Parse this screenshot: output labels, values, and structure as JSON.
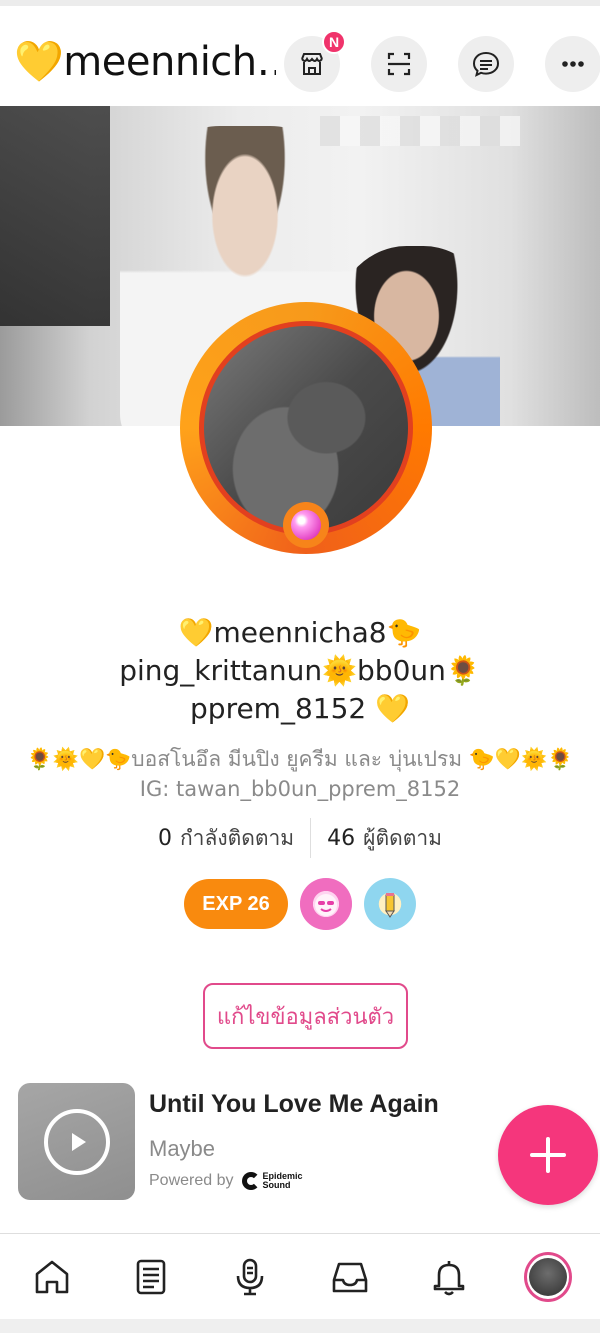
{
  "header": {
    "title": "💛meennich…",
    "shop_badge": "N"
  },
  "profile": {
    "names_line1": "💛meennicha8🐤",
    "names_line2": "ping_krittanun🌞bb0un🌻",
    "names_line3": "pprem_8152 💛",
    "bio_line1": "🌻🌞💛🐤บอสโนอึล มีนปิง ยูครีม และ บุ่นเปรม 🐤💛🌞🌻",
    "bio_line2": "IG: tawan_bb0un_pprem_8152",
    "following_count": "0",
    "following_label": "กำลังติดตาม",
    "followers_count": "46",
    "followers_label": "ผู้ติดตาม",
    "exp_label": "EXP 26",
    "edit_label": "แก้ไขข้อมูลส่วนตัว"
  },
  "music": {
    "title": "Until You Love Me Again",
    "artist": "Maybe",
    "powered_by": "Powered by",
    "brand_line1": "Epidemic",
    "brand_line2": "Sound"
  },
  "colors": {
    "accent_pink": "#f5367c",
    "exp_orange": "#f98a0e",
    "ring_orange": "#f79a1b"
  },
  "icons": {
    "header": [
      "shop-icon",
      "scan-icon",
      "message-icon",
      "more-icon"
    ],
    "nav": [
      "home-icon",
      "feed-icon",
      "microphone-icon",
      "inbox-icon",
      "bell-icon",
      "profile-avatar"
    ]
  }
}
